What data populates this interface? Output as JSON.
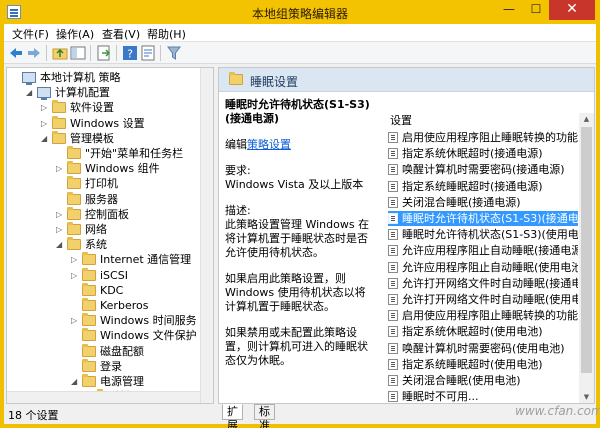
{
  "window": {
    "title": "本地组策略编辑器",
    "minimize": "—",
    "maximize": "☐",
    "close": "✕"
  },
  "menu": [
    "文件(F)",
    "操作(A)",
    "查看(V)",
    "帮助(H)"
  ],
  "tree": [
    {
      "label": "本地计算机 策略",
      "icon": "pc-icon",
      "indent": 0,
      "twisty": ""
    },
    {
      "label": "计算机配置",
      "icon": "pc-icon",
      "indent": 1,
      "twisty": "◢"
    },
    {
      "label": "软件设置",
      "icon": "folder-icon",
      "indent": 2,
      "twisty": "▷"
    },
    {
      "label": "Windows 设置",
      "icon": "folder-icon",
      "indent": 2,
      "twisty": "▷"
    },
    {
      "label": "管理模板",
      "icon": "folder-icon",
      "indent": 2,
      "twisty": "◢"
    },
    {
      "label": "\"开始\"菜单和任务栏",
      "icon": "folder-icon",
      "indent": 3,
      "twisty": ""
    },
    {
      "label": "Windows 组件",
      "icon": "folder-icon",
      "indent": 3,
      "twisty": "▷"
    },
    {
      "label": "打印机",
      "icon": "folder-icon",
      "indent": 3,
      "twisty": ""
    },
    {
      "label": "服务器",
      "icon": "folder-icon",
      "indent": 3,
      "twisty": ""
    },
    {
      "label": "控制面板",
      "icon": "folder-icon",
      "indent": 3,
      "twisty": "▷"
    },
    {
      "label": "网络",
      "icon": "folder-icon",
      "indent": 3,
      "twisty": "▷"
    },
    {
      "label": "系统",
      "icon": "folder-icon",
      "indent": 3,
      "twisty": "◢"
    },
    {
      "label": "Internet 通信管理",
      "icon": "folder-icon",
      "indent": 4,
      "twisty": "▷"
    },
    {
      "label": "iSCSI",
      "icon": "folder-icon",
      "indent": 4,
      "twisty": "▷"
    },
    {
      "label": "KDC",
      "icon": "folder-icon",
      "indent": 4,
      "twisty": ""
    },
    {
      "label": "Kerberos",
      "icon": "folder-icon",
      "indent": 4,
      "twisty": ""
    },
    {
      "label": "Windows 时间服务",
      "icon": "folder-icon",
      "indent": 4,
      "twisty": "▷"
    },
    {
      "label": "Windows 文件保护",
      "icon": "folder-icon",
      "indent": 4,
      "twisty": ""
    },
    {
      "label": "磁盘配额",
      "icon": "folder-icon",
      "indent": 4,
      "twisty": ""
    },
    {
      "label": "登录",
      "icon": "folder-icon",
      "indent": 4,
      "twisty": ""
    },
    {
      "label": "电源管理",
      "icon": "folder-icon",
      "indent": 4,
      "twisty": "◢"
    },
    {
      "label": "按钮设置",
      "icon": "folder-icon",
      "indent": 5,
      "twisty": ""
    }
  ],
  "right": {
    "header_title": "睡眠设置",
    "desc_title": "睡眠时允许待机状态(S1-S3)(接通电源)",
    "edit_prefix": "编辑",
    "edit_link": "策略设置",
    "req_label": "要求:",
    "req_value": "Windows Vista 及以上版本",
    "desc_label": "描述:",
    "desc_text": "此策略设置管理 Windows 在将计算机置于睡眠状态时是否允许使用待机状态。",
    "desc_enabled": "如果启用此策略设置，则 Windows 使用待机状态以将计算机置于睡眠状态。",
    "desc_disabled": "如果禁用或未配置此策略设置，则计算机可进入的睡眠状态仅为休眠。",
    "list_header": "设置",
    "items": [
      "启用使应用程序阻止睡眠转换的功能(接通电",
      "指定系统休眠超时(接通电源)",
      "唤醒计算机时需要密码(接通电源)",
      "指定系统睡眠超时(接通电源)",
      "关闭混合睡眠(接通电源)",
      "睡眠时允许待机状态(S1-S3)(接通电源)",
      "睡眠时允许待机状态(S1-S3)(使用电池)",
      "允许应用程序阻止自动睡眠(接通电源)",
      "允许应用程序阻止自动睡眠(使用电池)",
      "允许打开网络文件时自动睡眠(接通电源)",
      "允许打开网络文件时自动睡眠(使用电池)",
      "启用使应用程序阻止睡眠转换的功能(使用电",
      "指定系统休眠超时(使用电池)",
      "唤醒计算机时需要密码(使用电池)",
      "指定系统睡眠超时(使用电池)",
      "关闭混合睡眠(使用电池)",
      "睡眠时不可用..."
    ],
    "selected_index": 5
  },
  "tabs": [
    "扩展",
    "标准"
  ],
  "status": "18 个设置",
  "watermark": "www.cfan.com.cn",
  "colors": {
    "title_bar": "#f3c200",
    "selection": "#3399ff",
    "close": "#c7352b"
  }
}
